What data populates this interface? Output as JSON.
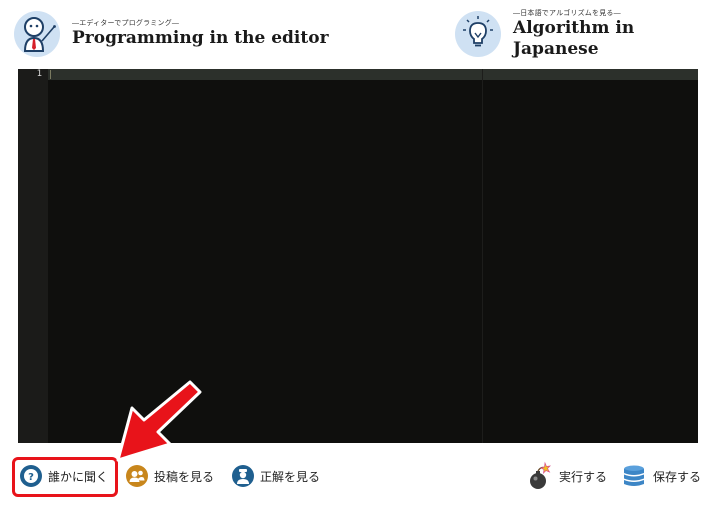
{
  "header": {
    "left_mode": {
      "subtitle": "―エディターでプログラミング―",
      "title": "Programming in the editor",
      "icon": "teacher-pointer-icon"
    },
    "right_mode": {
      "subtitle": "―日本語でアルゴリズムを見る―",
      "title": "Algorithm in Japanese",
      "icon": "lightbulb-icon"
    }
  },
  "editor": {
    "line_numbers": [
      "1"
    ],
    "content": ""
  },
  "toolbar": {
    "ask": {
      "label": "誰かに聞く",
      "icon": "question-icon",
      "color": "#1f5f8f"
    },
    "posts": {
      "label": "投稿を見る",
      "icon": "people-icon",
      "color": "#c8861c"
    },
    "answer": {
      "label": "正解を見る",
      "icon": "person-icon",
      "color": "#1f5f8f"
    },
    "run": {
      "label": "実行する",
      "icon": "bomb-icon"
    },
    "save": {
      "label": "保存する",
      "icon": "database-icon"
    }
  },
  "annotation": {
    "highlight_color": "#e8131a"
  }
}
